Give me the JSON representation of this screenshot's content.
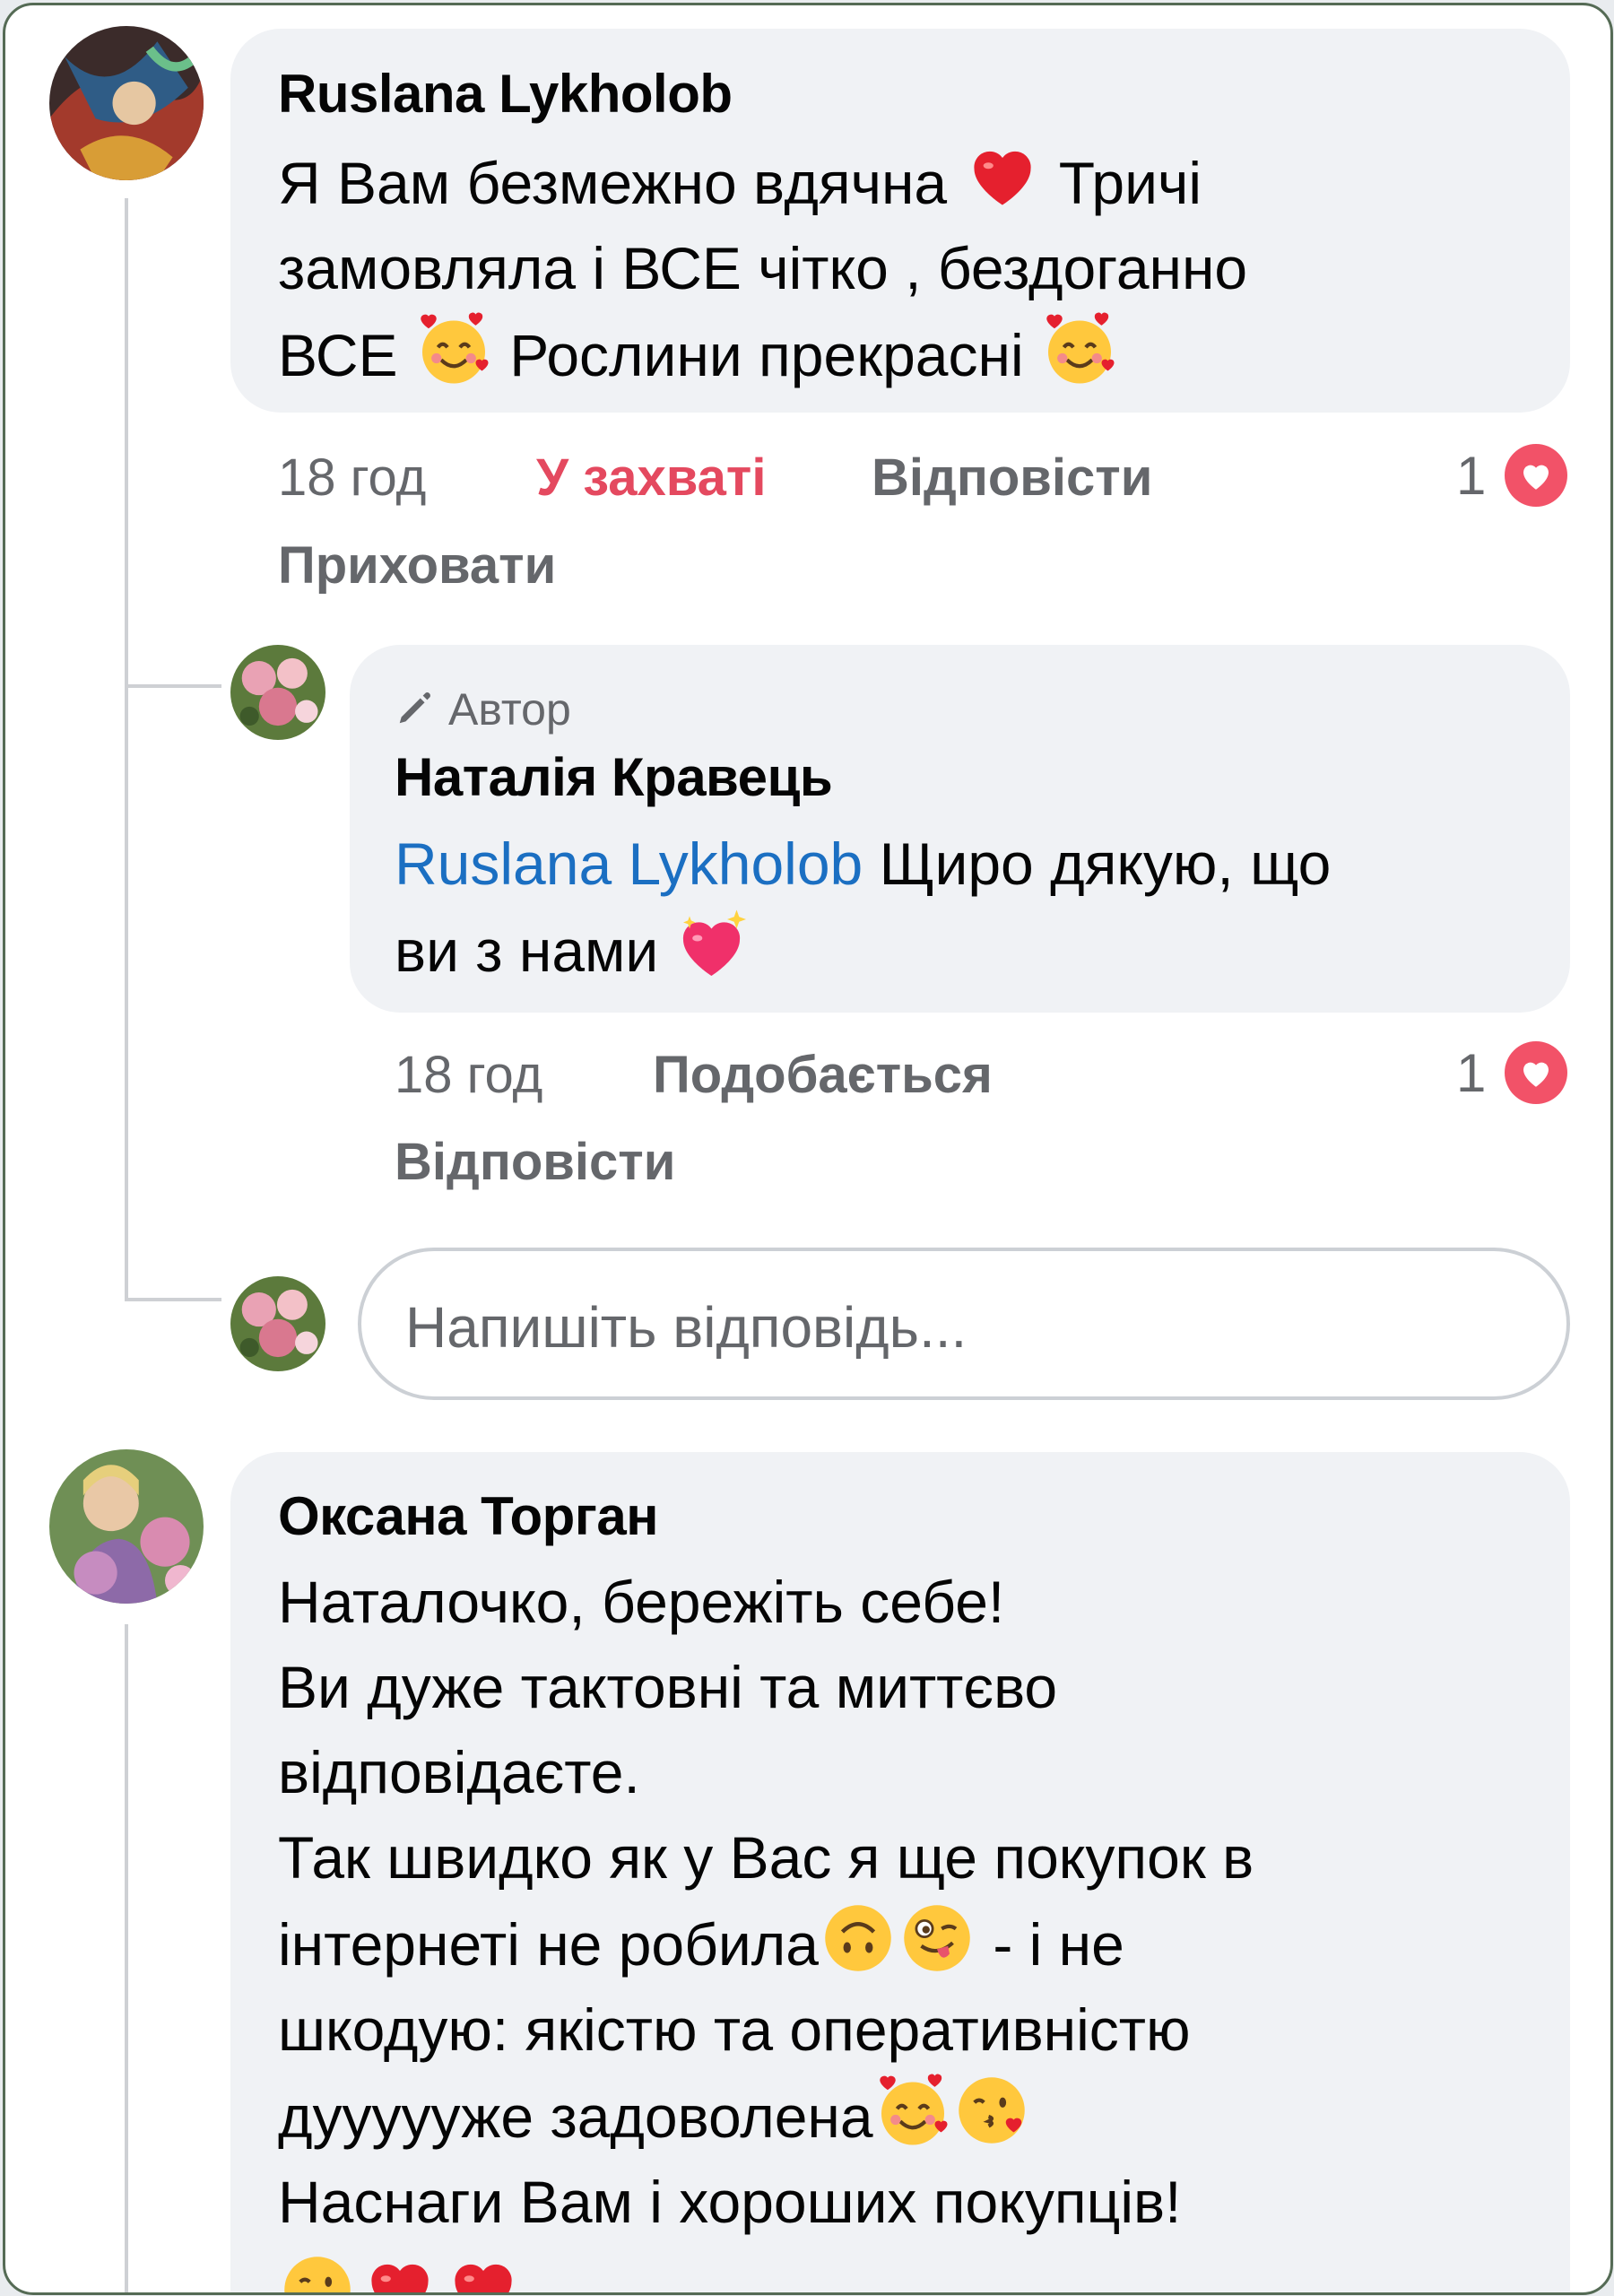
{
  "comments": [
    {
      "author": "Ruslana Lykholob",
      "lines": [
        [
          "Я Вам безмежно вдячна ",
          "heart",
          " Тричі"
        ],
        [
          "замовляла і ВСЕ чітко , бездоганно"
        ],
        [
          "ВСЕ ",
          "smiling-face-with-hearts",
          " Рослини прекрасні ",
          "smiling-face-with-hearts"
        ]
      ],
      "time": "18 год",
      "reaction_label": "У захваті",
      "reply_label": "Відповісти",
      "hide_label": "Приховати",
      "reaction_count": "1"
    },
    {
      "author_badge": "Автор",
      "author": "Наталія Кравець",
      "mention": "Ruslana Lykholob",
      "line1_rest": " Щиро дякую, що",
      "line2": "ви з нами ",
      "line2_emoji": "sparkling-heart",
      "time": "18 год",
      "like_label": "Подобається",
      "reply_label": "Відповісти",
      "reaction_count": "1"
    },
    {
      "author": "Оксана Торган",
      "lines": [
        [
          "Наталочко, бережіть себе!"
        ],
        [
          "Ви дуже тактовні та миттєво"
        ],
        [
          "відповідаєте."
        ],
        [
          "Так швидко як у Вас я ще покупок в"
        ],
        [
          "інтернеті не робила",
          "upside-down-face",
          "winking-face-with-tongue",
          " - і не"
        ],
        [
          "шкодую: якістю та оперативністю"
        ],
        [
          "дуууууже задоволена",
          "smiling-face-with-hearts",
          "face-blowing-kiss"
        ],
        [
          "Наснаги Вам і хороших покупців!"
        ]
      ]
    }
  ],
  "reply_input": {
    "placeholder": "Напишіть відповідь..."
  },
  "colors": {
    "bubble": "#f0f2f5",
    "love_reaction": "#e4495f",
    "mention": "#1b6fc2",
    "meta_text": "#65676b",
    "frame_border": "#556b55"
  },
  "icons": [
    "pencil-icon",
    "love-reaction-icon",
    "avatar"
  ]
}
